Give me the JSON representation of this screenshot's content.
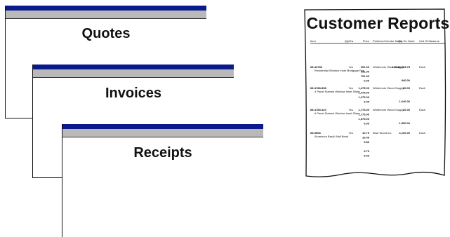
{
  "windows": [
    {
      "title": "Quotes"
    },
    {
      "title": "Invoices"
    },
    {
      "title": "Receipts"
    }
  ],
  "report": {
    "title": "Customer Reports",
    "columns": [
      "Item",
      "Qty/Ea",
      "Price",
      "Preferred Vendor Name",
      "Qty On Hand",
      "Unit Of Measure"
    ],
    "rows": [
      {
        "item": "IM-43789",
        "desc": "Residential Window Inset Mortgage Fee",
        "qty": "Yes",
        "prices": [
          "991.00",
          "991.00",
          "791.00",
          "0.00"
        ],
        "vendor": "Whitemore Wood Supply",
        "onhand": [
          "1,6x44,253.78",
          "",
          "840.00"
        ],
        "uom": "Each"
      },
      {
        "item": "IM-4788-558",
        "desc": "4 Panel Stained Window Inset Slider",
        "qty": "Yes",
        "prices": [
          "1,475.00",
          "1,475.00",
          "1,275.00",
          "0.00"
        ],
        "vendor": "Whitemore Wood Supply",
        "onhand": [
          "30.00",
          "",
          "1,640.00"
        ],
        "uom": "Each"
      },
      {
        "item": "IM-4789-4e0",
        "desc": "6 Panel Stained Window Inset Slider",
        "qty": "Yes",
        "prices": [
          "1,775.00",
          "1,775.00",
          "1,575.00",
          "0.00"
        ],
        "vendor": "Whitemore Wood Supply",
        "onhand": [
          "10.00",
          "",
          "1,550.00"
        ],
        "uom": "Each"
      },
      {
        "item": "IM-5508",
        "desc": "Aluminum Bas/k Wall Bead",
        "qty": "Yes",
        "prices": [
          "10.75",
          "10.45",
          "9.86",
          "",
          "9.75",
          "0.00"
        ],
        "vendor": "Bear Wood Inc.",
        "onhand": [
          "4,100.00"
        ],
        "uom": "Each"
      }
    ]
  }
}
